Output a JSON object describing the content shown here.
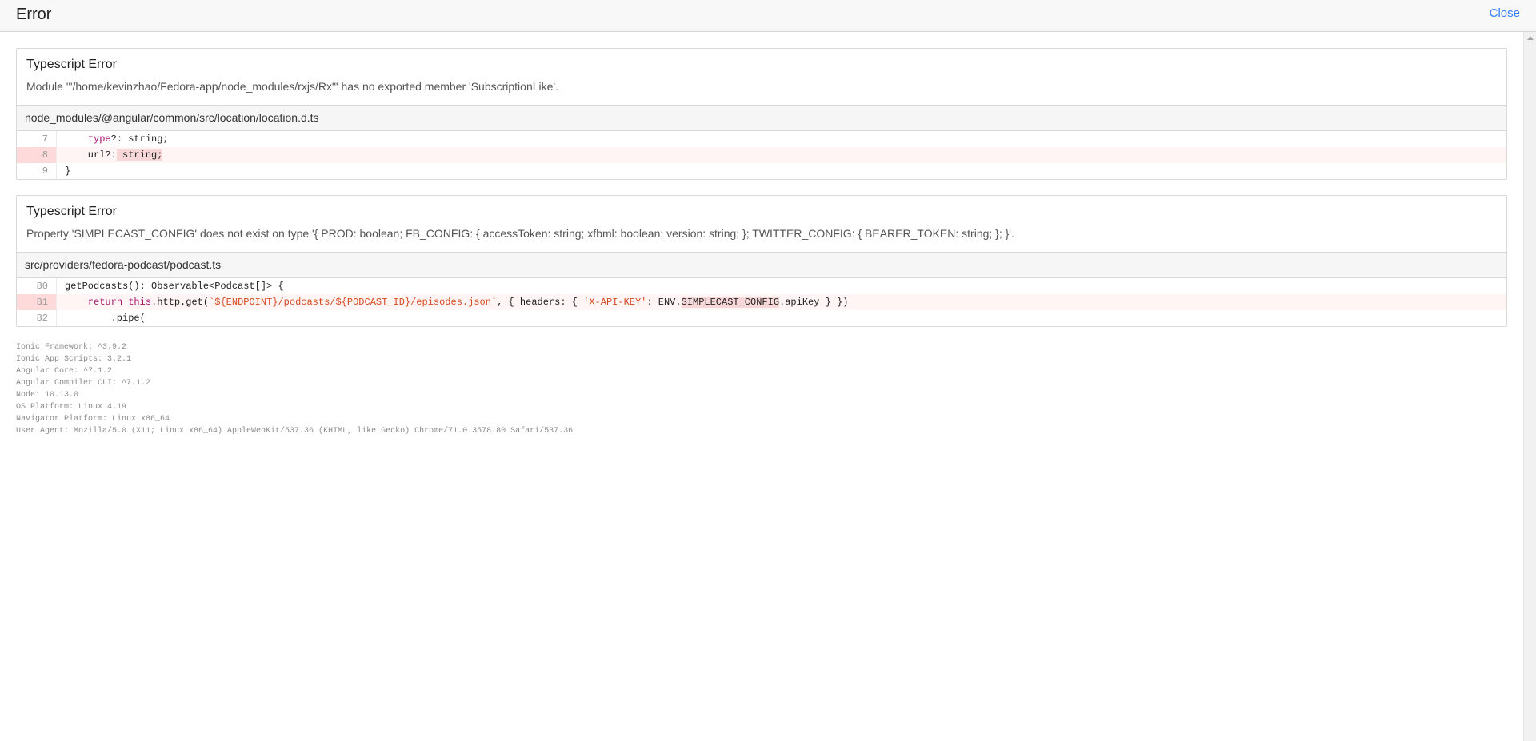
{
  "header": {
    "title": "Error",
    "close_label": "Close"
  },
  "errors": [
    {
      "title": "Typescript Error",
      "message": "Module '\"/home/kevinzhao/Fedora-app/node_modules/rxjs/Rx\"' has no exported member 'SubscriptionLike'.",
      "file": "node_modules/@angular/common/src/location/location.d.ts",
      "lines": [
        {
          "num": "7",
          "indent": "    ",
          "kw": "type",
          "rest": "?: string;"
        },
        {
          "num": "8",
          "pre": "    url?:",
          "mark": " string;"
        },
        {
          "num": "9",
          "text": "}"
        }
      ]
    },
    {
      "title": "Typescript Error",
      "message": "Property 'SIMPLECAST_CONFIG' does not exist on type '{ PROD: boolean; FB_CONFIG: { accessToken: string; xfbml: boolean; version: string; }; TWITTER_CONFIG: { BEARER_TOKEN: string; }; }'.",
      "file": "src/providers/fedora-podcast/podcast.ts",
      "lines": [
        {
          "num": "80",
          "text": "getPodcasts(): Observable<Podcast[]> {"
        },
        {
          "num": "81",
          "indent": "    ",
          "kw1": "return",
          "sp": " ",
          "kw2": "this",
          "a": ".http.get(",
          "s1": "`${ENDPOINT}/podcasts/${PODCAST_ID}/episodes.json`",
          "b": ", { headers: { ",
          "s2": "'X-API-KEY'",
          "c": ": ENV.",
          "mark": "SIMPLECAST_CONFIG",
          "d": ".apiKey } })"
        },
        {
          "num": "82",
          "text": "        .pipe("
        }
      ]
    }
  ],
  "meta": [
    "Ionic Framework: ^3.9.2",
    "Ionic App Scripts: 3.2.1",
    "Angular Core: ^7.1.2",
    "Angular Compiler CLI: ^7.1.2",
    "Node: 10.13.0",
    "OS Platform: Linux 4.19",
    "Navigator Platform: Linux x86_64",
    "User Agent: Mozilla/5.0 (X11; Linux x86_64) AppleWebKit/537.36 (KHTML, like Gecko) Chrome/71.0.3578.80 Safari/537.36"
  ]
}
